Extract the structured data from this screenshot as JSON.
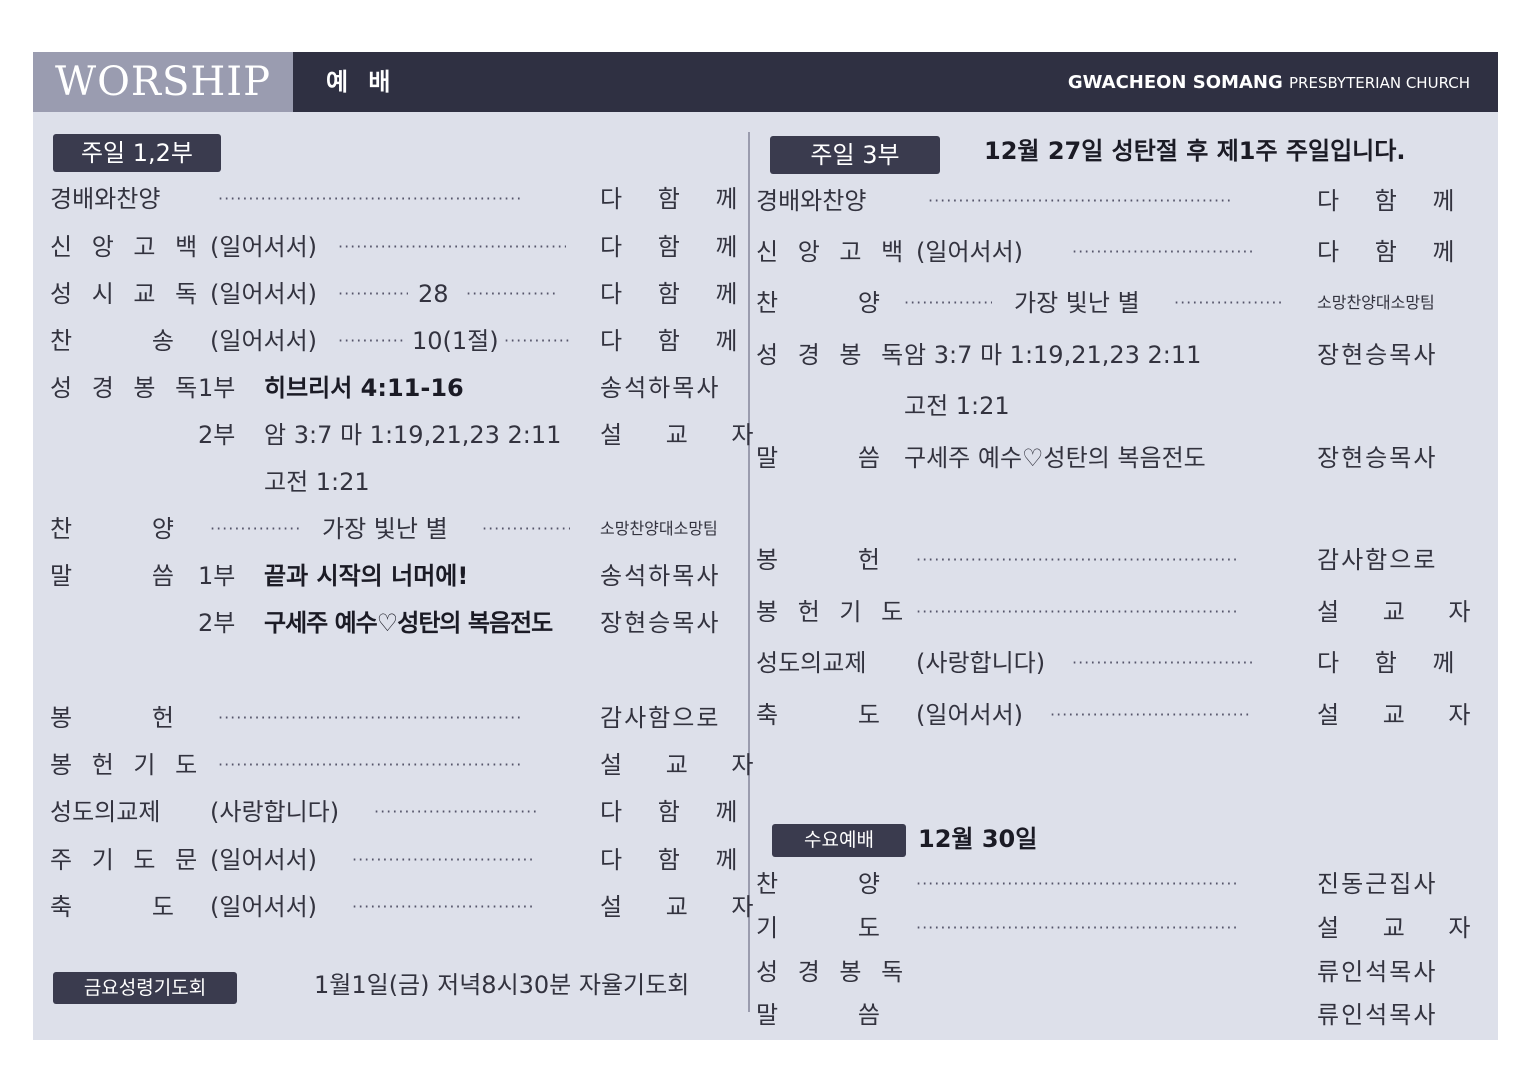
{
  "header": {
    "title_en": "WORSHIP",
    "title_kor": "예 배",
    "church_main": "GWACHEON SOMANG",
    "church_sub": "PRESBYTERIAN CHURCH"
  },
  "left": {
    "badge": "주일 1,2부",
    "rows": {
      "r1": {
        "label": "경배와찬양",
        "right": "다 함 께"
      },
      "r2": {
        "label": "신 앙 고 백",
        "mid": "(일어서서)",
        "right": "다 함 께"
      },
      "r3": {
        "label": "성 시 교 독",
        "mid": "(일어서서)",
        "num": "28",
        "right": "다 함 께"
      },
      "r4": {
        "label": "찬 송",
        "mid": "(일어서서)",
        "num": "10(1절)",
        "right": "다 함 께"
      },
      "r5": {
        "label": "성 경 봉 독",
        "part": "1부",
        "text": "히브리서 4:11-16",
        "right": "송석하목사"
      },
      "r6": {
        "part": "2부",
        "text": "암 3:7  마 1:19,21,23 2:11",
        "right": "설 교 자"
      },
      "r7": {
        "text": "고전 1:21"
      },
      "r8": {
        "label": "찬 양",
        "text": "가장 빛난 별",
        "right": "소망찬양대소망팀"
      },
      "r9": {
        "label": "말 씀",
        "part": "1부",
        "text": "끝과 시작의 너머에!",
        "right": "송석하목사"
      },
      "r10": {
        "part": "2부",
        "text": "구세주 예수♡성탄의 복음전도",
        "right": "장현승목사"
      },
      "r11": {
        "label": "봉 헌",
        "right": "감사함으로"
      },
      "r12": {
        "label": "봉 헌 기 도",
        "right": "설 교 자"
      },
      "r13": {
        "label": "성도의교제",
        "mid": "(사랑합니다)",
        "right": "다 함 께"
      },
      "r14": {
        "label": "주 기 도 문",
        "mid": "(일어서서)",
        "right": "다 함 께"
      },
      "r15": {
        "label": "축 도",
        "mid": "(일어서서)",
        "right": "설 교 자"
      }
    },
    "friday_badge": "금요성령기도회",
    "friday_text": "1월1일(금) 저녁8시30분 자율기도회"
  },
  "rightcol": {
    "badge": "주일 3부",
    "heading": "12월 27일 성탄절 후 제1주 주일입니다.",
    "rows": {
      "r1": {
        "label": "경배와찬양",
        "right": "다 함 께"
      },
      "r2": {
        "label": "신 앙 고 백",
        "mid": "(일어서서)",
        "right": "다 함 께"
      },
      "r3": {
        "label": "찬 양",
        "text": "가장 빛난 별",
        "right": "소망찬양대소망팀"
      },
      "r4": {
        "label": "성 경 봉 독",
        "text": "암 3:7  마 1:19,21,23 2:11",
        "right": "장현승목사"
      },
      "r5": {
        "text": "고전 1:21"
      },
      "r6": {
        "label": "말 씀",
        "text": "구세주 예수♡성탄의 복음전도",
        "right": "장현승목사"
      },
      "r7": {
        "label": "봉 헌",
        "right": "감사함으로"
      },
      "r8": {
        "label": "봉 헌 기 도",
        "right": "설 교 자"
      },
      "r9": {
        "label": "성도의교제",
        "mid": "(사랑합니다)",
        "right": "다 함 께"
      },
      "r10": {
        "label": "축 도",
        "mid": "(일어서서)",
        "right": "설 교 자"
      }
    },
    "wed_badge": "수요예배",
    "wed_heading": "12월 30일",
    "wed_rows": {
      "w1": {
        "label": "찬 양",
        "right": "진동근집사"
      },
      "w2": {
        "label": "기 도",
        "right": "설 교 자"
      },
      "w3": {
        "label": "성 경 봉 독",
        "right": "류인석목사"
      },
      "w4": {
        "label": "말 씀",
        "right": "류인석목사"
      }
    }
  },
  "colors": {
    "header_bg": "#2f3042",
    "worship_box": "#9a9cb0",
    "card_bg": "#dde0ea",
    "badge_bg": "#3a3b4e"
  }
}
